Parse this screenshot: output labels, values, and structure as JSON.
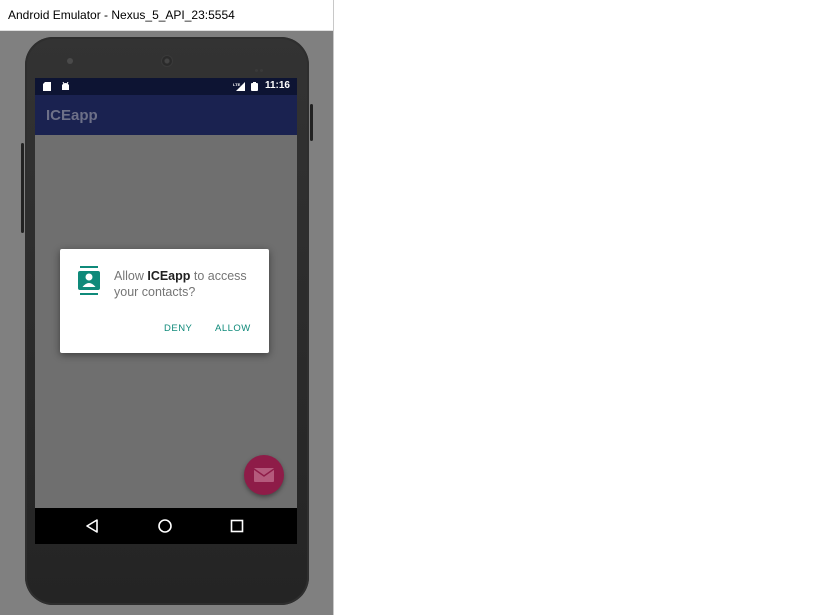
{
  "window": {
    "title": "Android Emulator - Nexus_5_API_23:5554"
  },
  "statusbar": {
    "time": "11:16",
    "icons": [
      "sd-card-icon",
      "android-debug-icon",
      "signal-lte-icon",
      "battery-icon"
    ]
  },
  "app": {
    "title": "ICEapp"
  },
  "dialog": {
    "prefix": "Allow ",
    "app_name": "ICEapp",
    "suffix": " to access your contacts?",
    "icon": "contacts-icon",
    "deny_label": "DENY",
    "allow_label": "ALLOW"
  },
  "fab": {
    "icon": "email-icon"
  },
  "navbar": {
    "icons": [
      "back-icon",
      "home-icon",
      "recents-icon"
    ]
  },
  "colors": {
    "accent": "#0f8a7a",
    "appbar": "#1a2250",
    "statusbar": "#0d1433",
    "fab": "#8e1c48"
  }
}
